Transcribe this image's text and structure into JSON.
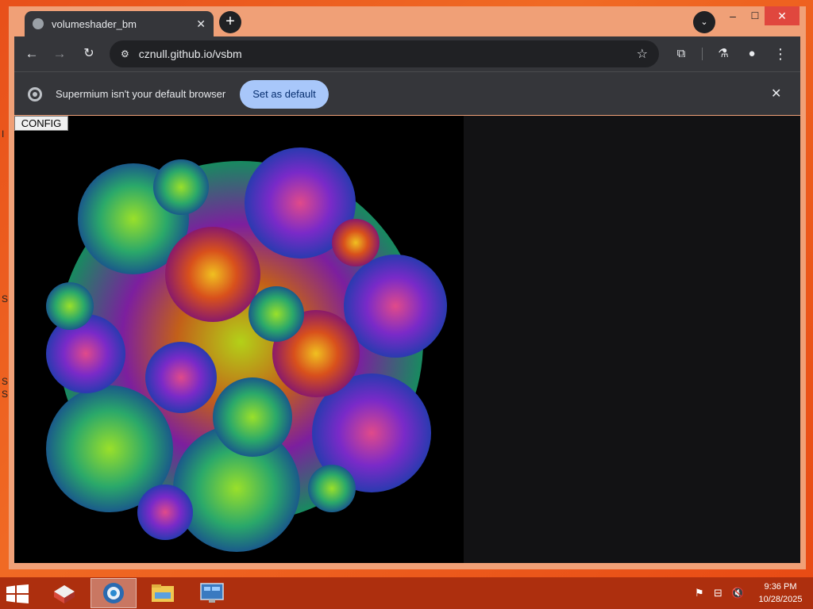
{
  "desktop": {
    "edge_glyphs": [
      "I",
      "S",
      "S",
      "S"
    ]
  },
  "browser": {
    "tab": {
      "title": "volumeshader_bm",
      "close": "✕"
    },
    "new_tab": "+",
    "tab_search": "⌄",
    "window_controls": {
      "minimize": "–",
      "maximize": "☐",
      "close": "✕"
    },
    "toolbar": {
      "back": "←",
      "forward": "→",
      "reload": "↻",
      "site_info": "⚙",
      "url": "cznull.github.io/vsbm",
      "bookmark": "☆",
      "extensions": "⧉",
      "labs": "⚗",
      "profile": "●",
      "menu": "⋮"
    },
    "infobar": {
      "message": "Supermium isn't your default browser",
      "set_default_label": "Set as default",
      "dismiss": "✕"
    }
  },
  "page": {
    "config_label": "CONFIG"
  },
  "taskbar": {
    "clock": {
      "time": "9:36 PM",
      "date": "10/28/2025"
    },
    "tray": {
      "flag": "⚑",
      "network": "⊟",
      "volume": "🔇"
    }
  },
  "colors": {
    "desktop": "#e8501a",
    "tab_bg": "#35363a",
    "omnibox_bg": "#202124",
    "button_blue": "#a8c7fa",
    "taskbar": "#ad2f0e",
    "canvas": "#000000",
    "page_bg": "#121214"
  },
  "icons": {
    "tab_favicon": "globe-icon",
    "infobar": "chromium-logo-icon",
    "start": "windows-logo-icon",
    "taskbar_apps": [
      "toolbox-icon",
      "browser-globe-icon",
      "file-explorer-icon",
      "control-panel-icon"
    ]
  }
}
